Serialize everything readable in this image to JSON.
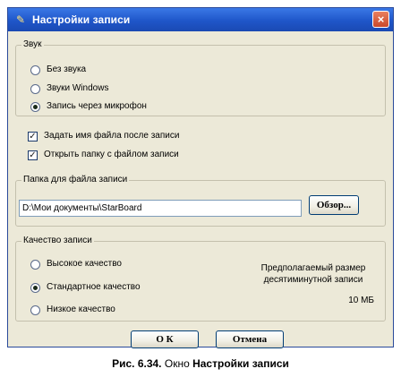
{
  "window": {
    "title": "Настройки записи",
    "close_glyph": "×"
  },
  "sound_group": {
    "label": "Звук",
    "options": [
      {
        "label": "Без звука",
        "checked": false
      },
      {
        "label": "Звуки Windows",
        "checked": false
      },
      {
        "label": "Запись через микрофон",
        "checked": true
      }
    ]
  },
  "checkboxes": [
    {
      "label": "Задать имя файла после записи",
      "checked": true
    },
    {
      "label": "Открыть папку с файлом записи",
      "checked": true
    }
  ],
  "folder_group": {
    "label": "Папка для файла записи",
    "path_value": "D:\\Мои документы\\StarBoard",
    "browse_label": "Обзор..."
  },
  "quality_group": {
    "label": "Качество записи",
    "options": [
      {
        "label": "Высокое качество",
        "checked": false
      },
      {
        "label": "Стандартное качество",
        "checked": true
      },
      {
        "label": "Низкое качество",
        "checked": false
      }
    ],
    "estimate_line1": "Предполагаемый размер",
    "estimate_line2": "десятиминутной записи",
    "estimate_value": "10 МБ"
  },
  "buttons": {
    "ok_label": "О К",
    "cancel_label": "Отмена"
  },
  "caption": {
    "prefix": "Рис. 6.34.",
    "middle": "Окно",
    "bold": "Настройки записи"
  }
}
